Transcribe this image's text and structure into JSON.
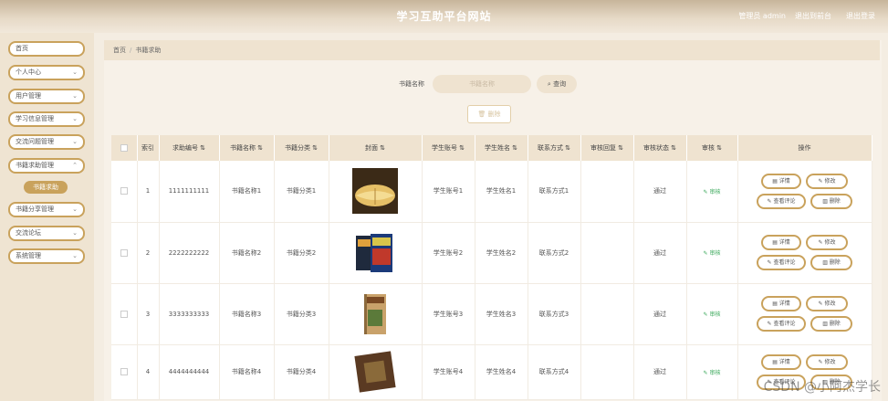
{
  "header": {
    "title": "学习互助平台网站",
    "user": "管理员 admin",
    "links": [
      "退出到前台",
      "退出登录"
    ]
  },
  "sidebar": {
    "items": [
      {
        "label": "首页",
        "chevron": ""
      },
      {
        "label": "个人中心",
        "chevron": "⌄"
      },
      {
        "label": "用户管理",
        "chevron": "⌄"
      },
      {
        "label": "学习信息管理",
        "chevron": "⌄"
      },
      {
        "label": "交流问题管理",
        "chevron": "⌄"
      },
      {
        "label": "书籍求助管理",
        "chevron": "⌃"
      },
      {
        "label": "书籍分享管理",
        "chevron": "⌄"
      },
      {
        "label": "交流论坛",
        "chevron": "⌄"
      },
      {
        "label": "系统管理",
        "chevron": "⌄"
      }
    ],
    "active_sub": "书籍求助"
  },
  "breadcrumb": {
    "home": "首页",
    "current": "书籍求助"
  },
  "search": {
    "label": "书籍名称",
    "placeholder": "书籍名称",
    "button": "查询",
    "button_icon": "search-icon"
  },
  "toolbar": {
    "delete_label": "删除"
  },
  "table": {
    "headers": [
      "索引",
      "求助编号",
      "书籍名称",
      "书籍分类",
      "封面",
      "学生账号",
      "学生姓名",
      "联系方式",
      "审核回复",
      "审核状态",
      "审核",
      "操作"
    ],
    "rows": [
      {
        "index": "1",
        "code": "1111111111",
        "name": "书籍名称1",
        "category": "书籍分类1",
        "account": "学生账号1",
        "student": "学生姓名1",
        "contact": "联系方式1",
        "reply": "",
        "status": "通过",
        "audit": "审核"
      },
      {
        "index": "2",
        "code": "2222222222",
        "name": "书籍名称2",
        "category": "书籍分类2",
        "account": "学生账号2",
        "student": "学生姓名2",
        "contact": "联系方式2",
        "reply": "",
        "status": "通过",
        "audit": "审核"
      },
      {
        "index": "3",
        "code": "3333333333",
        "name": "书籍名称3",
        "category": "书籍分类3",
        "account": "学生账号3",
        "student": "学生姓名3",
        "contact": "联系方式3",
        "reply": "",
        "status": "通过",
        "audit": "审核"
      },
      {
        "index": "4",
        "code": "4444444444",
        "name": "书籍名称4",
        "category": "书籍分类4",
        "account": "学生账号4",
        "student": "学生姓名4",
        "contact": "联系方式4",
        "reply": "",
        "status": "通过",
        "audit": "审核"
      }
    ],
    "actions": {
      "detail": "详情",
      "edit": "修改",
      "comments": "查看评论",
      "delete": "删除"
    }
  },
  "watermark": "CSDN @小阿杰学长",
  "colors": {
    "accent": "#c9a25c",
    "topbar": "#c7b59b",
    "header_row": "#efe3d0",
    "audit_green": "#3aa85a"
  }
}
